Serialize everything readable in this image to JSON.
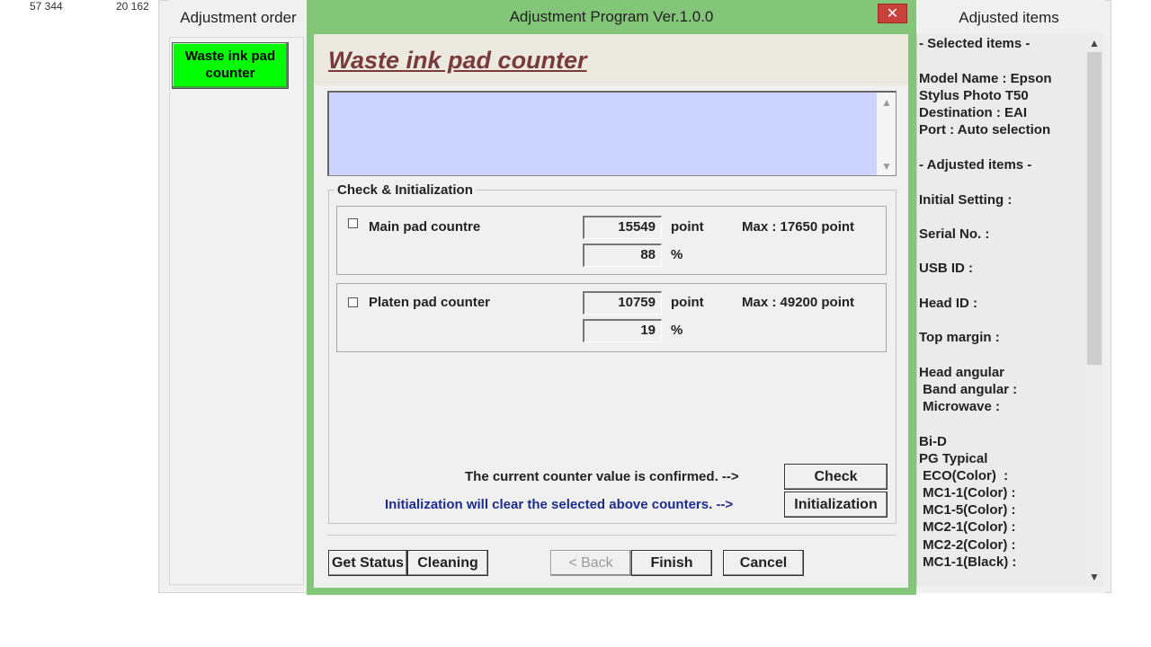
{
  "background": {
    "left_number": "57 344",
    "right_number": "20 162"
  },
  "left_pane": {
    "title": "Adjustment order",
    "waste_button": "Waste ink pad counter"
  },
  "dialog": {
    "title": "Adjustment Program Ver.1.0.0",
    "close_symbol": "✕",
    "heading": "Waste ink pad counter",
    "group_label": "Check & Initialization",
    "main_pad": {
      "label": "Main pad countre",
      "point_value": "15549",
      "percent_value": "88",
      "point_unit": "point",
      "percent_unit": "%",
      "max_text": "Max : 17650 point"
    },
    "platen_pad": {
      "label": "Platen pad counter",
      "point_value": "10759",
      "percent_value": "19",
      "point_unit": "point",
      "percent_unit": "%",
      "max_text": "Max : 49200 point"
    },
    "confirm_text": "The current counter value is confirmed. -->",
    "init_text": "Initialization will clear the selected above counters. -->",
    "check_button": "Check",
    "init_button": "Initialization",
    "footer": {
      "get_status": "Get Status",
      "cleaning": "Cleaning",
      "back": "< Back",
      "finish": "Finish",
      "cancel": "Cancel"
    }
  },
  "right_pane": {
    "title": "Adjusted items",
    "lines": [
      "- Selected items -",
      "Model Name : Epson",
      "Stylus Photo T50",
      "Destination : EAI",
      "Port : Auto selection",
      "- Adjusted items -",
      "Initial Setting :",
      "Serial No. :",
      "USB ID :",
      "Head ID :",
      "Top margin :",
      "Head angular",
      " Band angular :",
      " Microwave :",
      "Bi-D",
      "PG Typical",
      " ECO(Color)  :",
      " MC1-1(Color) :",
      " MC1-5(Color) :",
      " MC2-1(Color) :",
      " MC2-2(Color) :",
      " MC1-1(Black) :"
    ]
  },
  "colors": {
    "dialog_border": "#84c679",
    "waste_button": "#00ff00",
    "heading": "#7b3a3a",
    "message_box": "#ccd4ff",
    "init_text": "#1e2d8c",
    "close": "#c9413b"
  }
}
